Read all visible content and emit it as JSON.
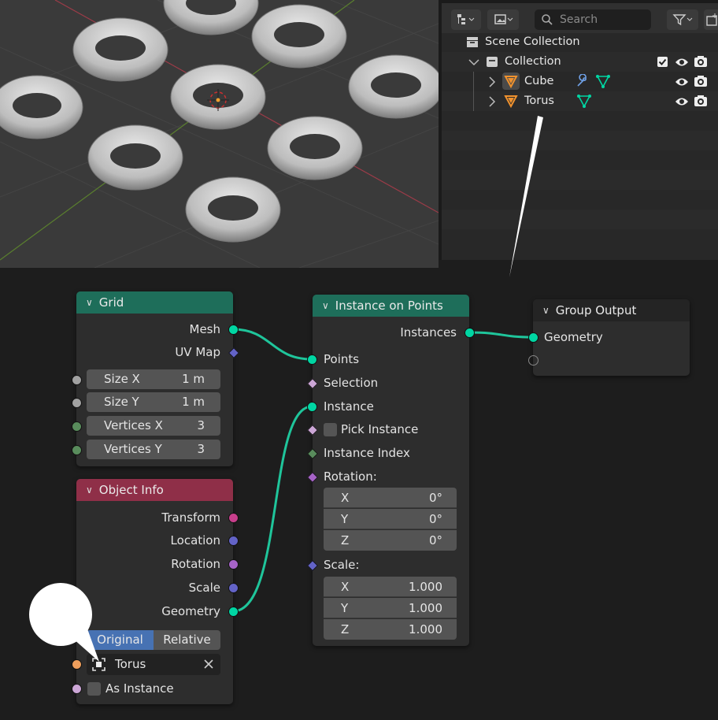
{
  "outliner": {
    "search_placeholder": "Search",
    "scene_collection": "Scene Collection",
    "collection": "Collection",
    "items": [
      {
        "label": "Cube"
      },
      {
        "label": "Torus"
      }
    ]
  },
  "nodes": {
    "grid": {
      "title": "Grid",
      "outputs": [
        "Mesh",
        "UV Map"
      ],
      "fields": [
        {
          "label": "Size X",
          "value": "1 m"
        },
        {
          "label": "Size Y",
          "value": "1 m"
        },
        {
          "label": "Vertices X",
          "value": "3"
        },
        {
          "label": "Vertices Y",
          "value": "3"
        }
      ]
    },
    "object_info": {
      "title": "Object Info",
      "outputs": [
        "Transform",
        "Location",
        "Rotation",
        "Scale",
        "Geometry"
      ],
      "mode_original": "Original",
      "mode_relative": "Relative",
      "object_value": "Torus",
      "as_instance": "As Instance"
    },
    "instance_on_points": {
      "title": "Instance on Points",
      "output": "Instances",
      "inputs": {
        "points": "Points",
        "selection": "Selection",
        "instance": "Instance",
        "pick_instance": "Pick Instance",
        "instance_index": "Instance Index",
        "rotation": "Rotation:",
        "scale": "Scale:"
      },
      "rotation": [
        {
          "axis": "X",
          "value": "0°"
        },
        {
          "axis": "Y",
          "value": "0°"
        },
        {
          "axis": "Z",
          "value": "0°"
        }
      ],
      "scale": [
        {
          "axis": "X",
          "value": "1.000"
        },
        {
          "axis": "Y",
          "value": "1.000"
        },
        {
          "axis": "Z",
          "value": "1.000"
        }
      ]
    },
    "group_output": {
      "title": "Group Output",
      "input": "Geometry"
    }
  },
  "colors": {
    "geometry_socket": "#00d6a3",
    "grid_header": "#1e6e5a",
    "object_info_header": "#8f2f48",
    "output_header": "#242424",
    "vector_socket": "#6363c7",
    "float_socket": "#a1a1a1",
    "int_socket": "#598c5c",
    "bool_socket": "#cca6d6",
    "matrix_socket": "#c83f8c",
    "rotation_socket": "#a663c7",
    "object_socket": "#ed9e5c",
    "active_toggle": "#4772b3",
    "link": "#1fc59b"
  }
}
